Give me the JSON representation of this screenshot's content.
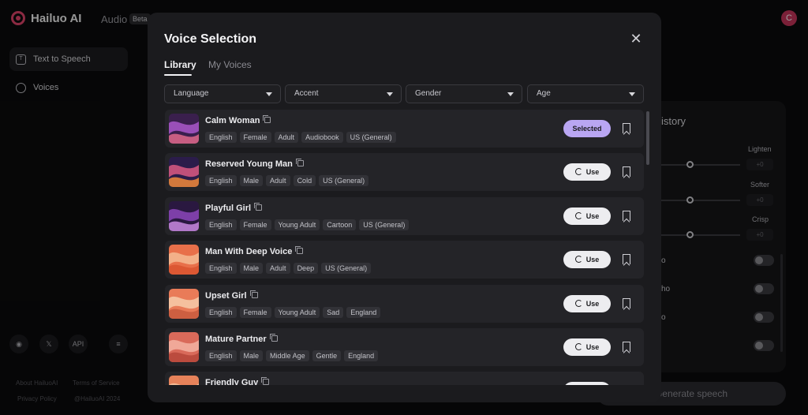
{
  "app": {
    "logo_text": "Hailuo AI",
    "top_nav": "Audio",
    "beta_badge": "Beta",
    "avatar_letter": "C"
  },
  "sidebar": {
    "items": [
      {
        "label": "Text to Speech",
        "icon": "text-speech-icon",
        "active": true
      },
      {
        "label": "Voices",
        "icon": "voices-icon",
        "active": false
      }
    ],
    "social": [
      "discord-icon",
      "x-icon",
      "API",
      "menu-icon"
    ],
    "social_api_label": "API",
    "footer": {
      "about": "About HailuoAI",
      "terms": "Terms of Service",
      "privacy": "Privacy Policy",
      "copyright": "@HailuoAI 2024"
    }
  },
  "right_panel": {
    "history_title": "istory",
    "sliders": [
      {
        "label": "Lighten",
        "value": "+0"
      },
      {
        "label": "Softer",
        "value": "+0"
      },
      {
        "label": "Crisp",
        "value": "+0"
      }
    ],
    "toggles": [
      {
        "label": "o"
      },
      {
        "label": "ho"
      },
      {
        "label": "o"
      },
      {
        "label": ""
      }
    ],
    "generate_label": "Generate speech"
  },
  "modal": {
    "title": "Voice Selection",
    "tabs": [
      {
        "label": "Library",
        "active": true
      },
      {
        "label": "My Voices",
        "active": false
      }
    ],
    "filters": [
      {
        "label": "Language"
      },
      {
        "label": "Accent"
      },
      {
        "label": "Gender"
      },
      {
        "label": "Age"
      }
    ],
    "voices": [
      {
        "name": "Calm Woman",
        "tags": [
          "English",
          "Female",
          "Adult",
          "Audiobook",
          "US (General)"
        ],
        "action": "Selected",
        "colors": [
          "#3a1f4d",
          "#9a4fb8",
          "#e06a8c"
        ]
      },
      {
        "name": "Reserved Young Man",
        "tags": [
          "English",
          "Male",
          "Adult",
          "Cold",
          "US (General)"
        ],
        "action": "Use",
        "colors": [
          "#2b1c4a",
          "#c0507a",
          "#f08a3a"
        ]
      },
      {
        "name": "Playful Girl",
        "tags": [
          "English",
          "Female",
          "Young Adult",
          "Cartoon",
          "US (General)"
        ],
        "action": "Use",
        "colors": [
          "#2a1840",
          "#7d3fa8",
          "#c98ae0"
        ]
      },
      {
        "name": "Man With Deep Voice",
        "tags": [
          "English",
          "Male",
          "Adult",
          "Deep",
          "US (General)"
        ],
        "action": "Use",
        "colors": [
          "#e8704a",
          "#f3b088",
          "#d9532f"
        ]
      },
      {
        "name": "Upset Girl",
        "tags": [
          "English",
          "Female",
          "Young Adult",
          "Sad",
          "England"
        ],
        "action": "Use",
        "colors": [
          "#e97b58",
          "#f5c09e",
          "#c85a3d"
        ]
      },
      {
        "name": "Mature Partner",
        "tags": [
          "English",
          "Male",
          "Middle Age",
          "Gentle",
          "England"
        ],
        "action": "Use",
        "colors": [
          "#d96a5a",
          "#f0a898",
          "#b5453a"
        ]
      },
      {
        "name": "Friendly Guy",
        "tags": [],
        "action": "Use",
        "colors": [
          "#e6825a",
          "#f4bb95",
          "#cf5c3a"
        ]
      }
    ]
  }
}
